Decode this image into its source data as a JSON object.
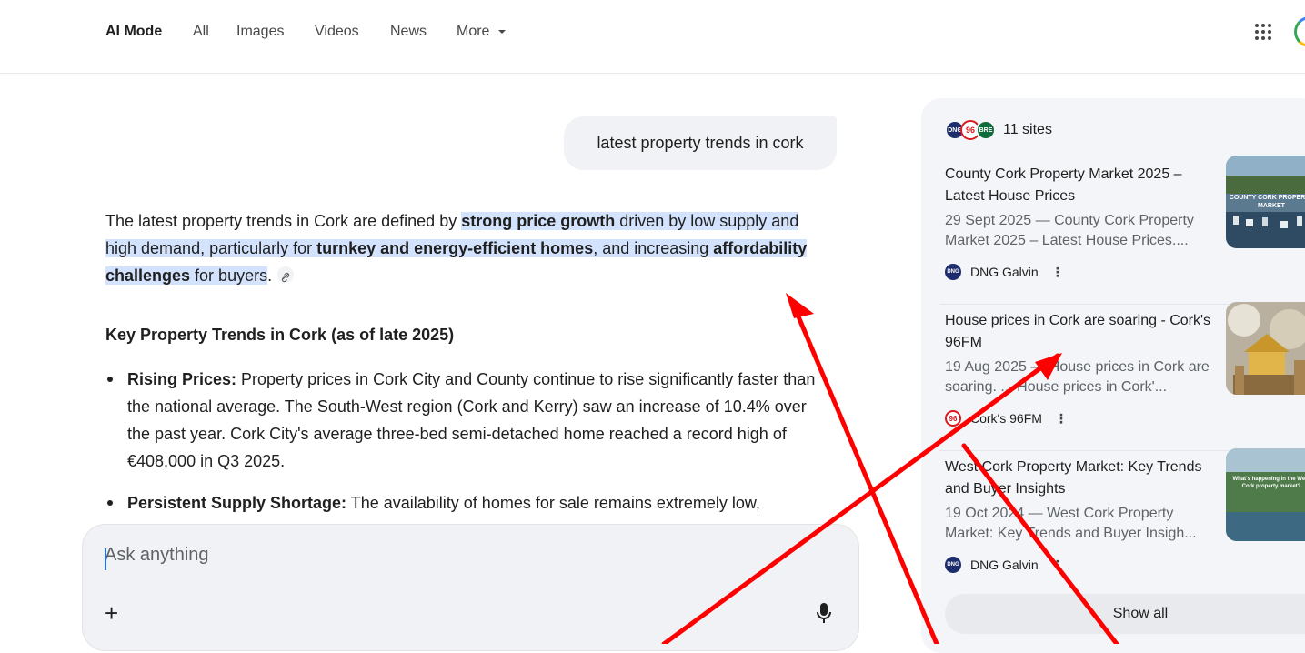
{
  "nav": {
    "tabs": [
      {
        "label": "AI Mode",
        "active": true
      },
      {
        "label": "All"
      },
      {
        "label": "Images"
      },
      {
        "label": "Videos"
      },
      {
        "label": "News"
      },
      {
        "label": "More"
      }
    ],
    "more_icon": "caret-down-icon",
    "apps_icon": "apps-grid-icon",
    "avatar_icon": "account-avatar"
  },
  "query": {
    "text": "latest property trends in cork"
  },
  "answer": {
    "p1": "The latest property trends in Cork are defined by ",
    "p2": "strong price growth",
    "p3": " driven by low supply and high demand, particularly for ",
    "p4": "turnkey and energy-efficient homes",
    "p5": ", and increasing ",
    "p6": "affordability challenges",
    "p7": " for buyers",
    "p8": ".",
    "link_icon": "link-icon",
    "heading": "Key Property Trends in Cork (as of late 2025)",
    "bullets": [
      {
        "label": "Rising Prices:",
        "text": " Property prices in Cork City and County continue to rise significantly faster than the national average. The South-West region (Cork and Kerry) saw an increase of 10.4% over the past year. Cork City's average three-bed semi-detached home reached a record high of €408,000 in Q3 2025."
      },
      {
        "label": "Persistent Supply Shortage:",
        "text": " The availability of homes for sale remains extremely low,"
      }
    ]
  },
  "ask": {
    "placeholder": "Ask anything",
    "plus": "+",
    "mic_icon": "microphone-icon"
  },
  "sources": {
    "count_label": "11 sites",
    "logos": [
      {
        "text": "DNG",
        "color": "#1d2d6b"
      },
      {
        "text": "96",
        "color": "#d71920"
      },
      {
        "text": "BRE",
        "color": "#0f6b3a"
      }
    ],
    "items": [
      {
        "title": "County Cork Property Market 2025 – Latest House Prices",
        "snippet": "29 Sept 2025 — County Cork Property Market 2025 – Latest House Prices....",
        "source": "DNG Galvin",
        "logo": "DNG",
        "thumb_text": "COUNTY CORK PROPERTY MARKET"
      },
      {
        "title": "House prices in Cork are soaring - Cork's 96FM",
        "snippet": "19 Aug 2025 — House prices in Cork are soaring. ... House prices in Cork'...",
        "source": "Cork's 96FM",
        "logo": "96",
        "thumb_text": ""
      },
      {
        "title": "West Cork Property Market: Key Trends and Buyer Insights",
        "snippet": "19 Oct 2024 — West Cork Property Market: Key Trends and Buyer Insigh...",
        "source": "DNG Galvin",
        "logo": "DNG",
        "thumb_text": "What's happening in the West Cork property market?"
      }
    ],
    "show_all": "Show all"
  },
  "annotation": {
    "arrow_color": "#ff0000"
  }
}
